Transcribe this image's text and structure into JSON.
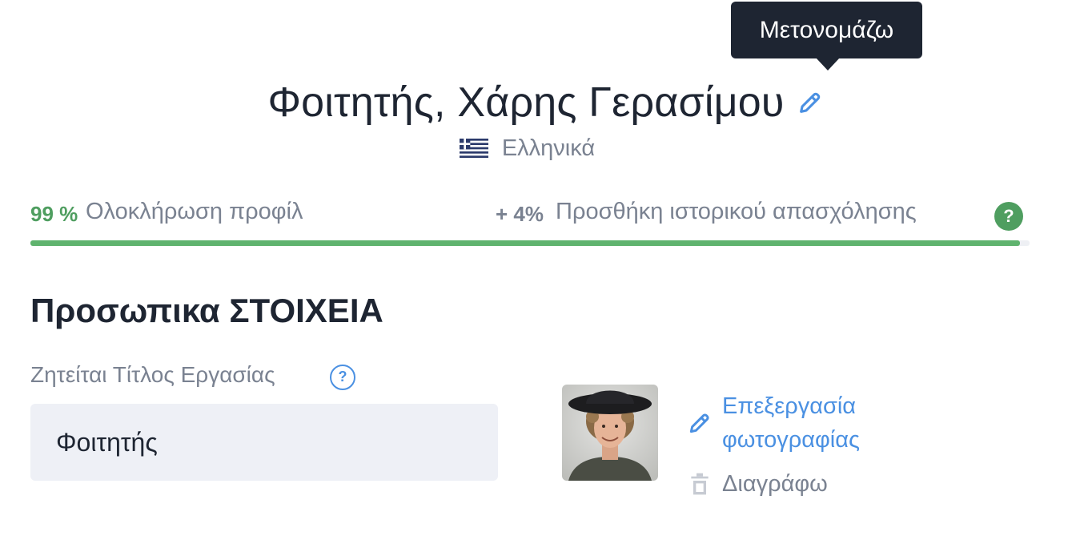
{
  "tooltip": {
    "text": "Μετονομάζω"
  },
  "profile": {
    "name": "Φοιτητής, Χάρης Γερασίμου",
    "language": "Ελληνικά"
  },
  "progress": {
    "completion_percent": "99 %",
    "completion_label": "Ολοκλήρωση προφίλ",
    "completion_value": 0.99,
    "suggestion_percent": "+ 4%",
    "suggestion_label": "Προσθήκη ιστορικού απασχόλησης",
    "help": "?"
  },
  "personal": {
    "section_title": "Προσωπικα ΣΤΟΙΧΕΙΑ",
    "job_title_label": "Ζητείται Τίτλος Εργασίας",
    "job_title_help": "?",
    "job_title_value": "Φοιτητής"
  },
  "photo": {
    "edit_label": "Επεξεργασία φωτογραφίας",
    "delete_label": "Διαγράφω"
  },
  "colors": {
    "accent_blue": "#4a90e2",
    "success_green": "#5fb36e",
    "text_dark": "#1e2532",
    "text_muted": "#7a8291"
  },
  "icons": {
    "rename": "pencil-icon",
    "flag": "greece-flag-icon",
    "help": "question-circle-icon",
    "edit_photo": "pencil-icon",
    "delete": "trash-icon"
  }
}
